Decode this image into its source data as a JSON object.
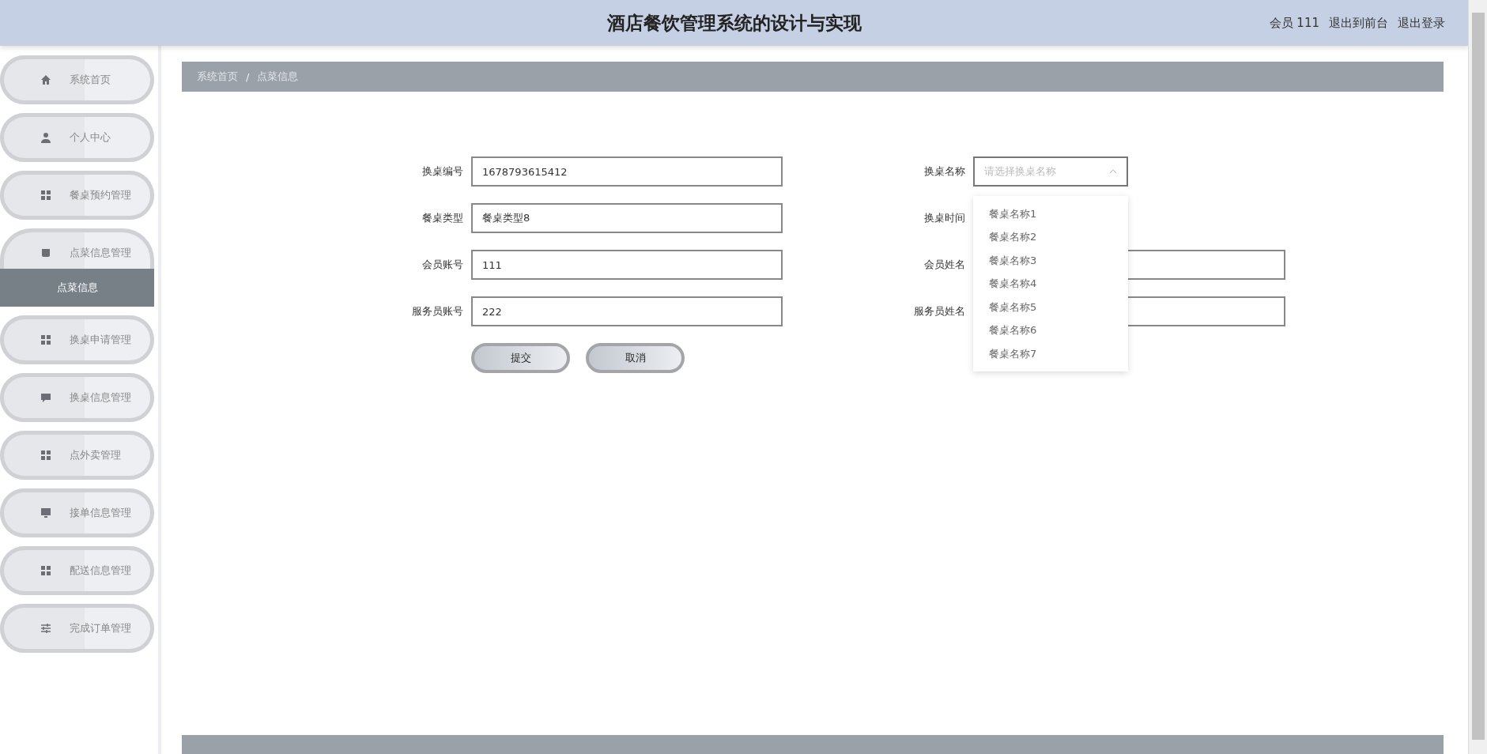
{
  "header": {
    "title": "酒店餐饮管理系统的设计与实现",
    "user": "会员 111",
    "links": [
      "退出到前台",
      "退出登录"
    ]
  },
  "sidebar": {
    "items": [
      {
        "label": "系统首页",
        "expanded": false
      },
      {
        "label": "个人中心",
        "expanded": false
      },
      {
        "label": "餐桌预约管理",
        "expanded": false
      },
      {
        "label": "点菜信息管理",
        "expanded": true,
        "children": [
          {
            "label": "点菜信息",
            "selected": true
          }
        ]
      },
      {
        "label": "换桌申请管理",
        "expanded": false
      },
      {
        "label": "换桌信息管理",
        "expanded": false
      },
      {
        "label": "点外卖管理",
        "expanded": false
      },
      {
        "label": "接单信息管理",
        "expanded": false
      },
      {
        "label": "配送信息管理",
        "expanded": false
      },
      {
        "label": "完成订单管理",
        "expanded": false
      }
    ]
  },
  "breadcrumb": {
    "items": [
      "系统首页",
      "点菜信息"
    ],
    "separator": "/"
  },
  "form": {
    "left": [
      {
        "label": "换桌编号",
        "value": "1678793615412"
      },
      {
        "label": "餐桌类型",
        "value": "餐桌类型8"
      },
      {
        "label": "会员账号",
        "value": "111"
      },
      {
        "label": "服务员账号",
        "value": "222"
      }
    ],
    "right": [
      {
        "label": "换桌名称",
        "kind": "select",
        "placeholder": "请选择换桌名称",
        "expanded": true,
        "options": [
          "餐桌名称1",
          "餐桌名称2",
          "餐桌名称3",
          "餐桌名称4",
          "餐桌名称5",
          "餐桌名称6",
          "餐桌名称7"
        ]
      },
      {
        "label": "换桌时间"
      },
      {
        "label": "会员姓名",
        "kind": "text"
      },
      {
        "label": "服务员姓名",
        "kind": "text"
      }
    ],
    "buttons": [
      "提交",
      "取消"
    ]
  }
}
